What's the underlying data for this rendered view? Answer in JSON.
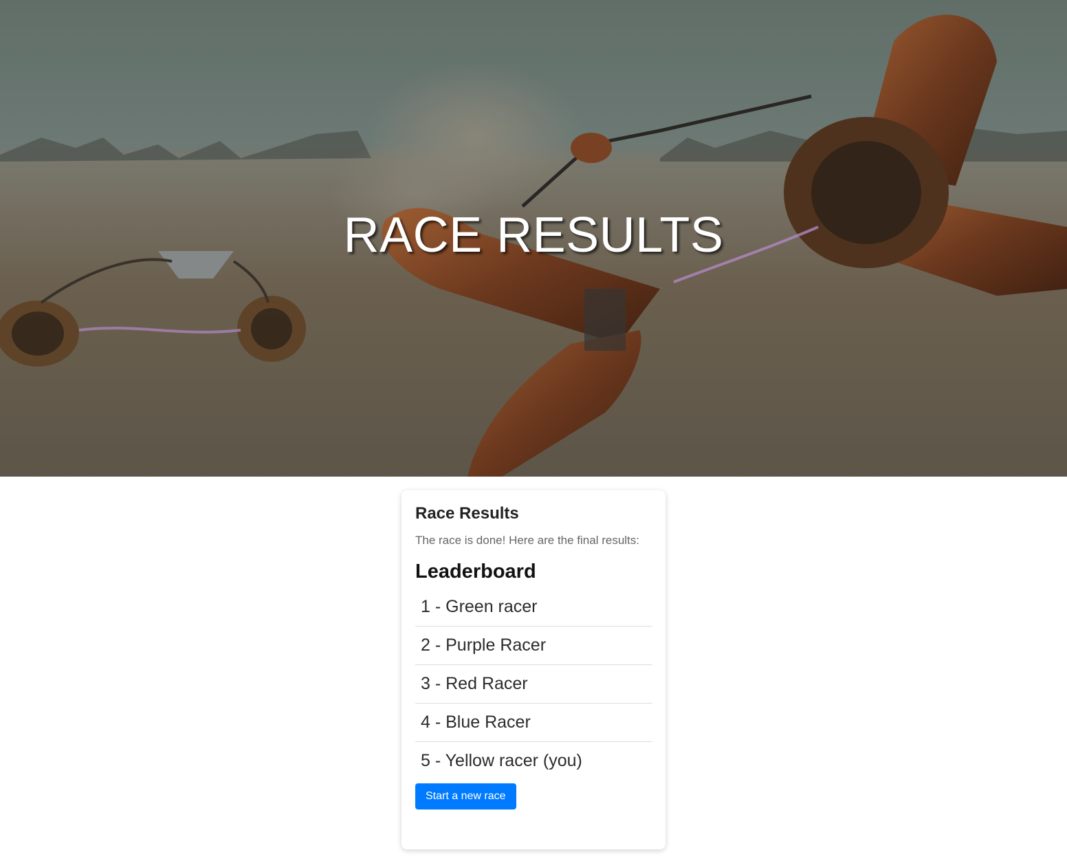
{
  "hero": {
    "title": "RACE RESULTS"
  },
  "card": {
    "title": "Race Results",
    "text": "The race is done! Here are the final results:",
    "leaderboard_heading": "Leaderboard",
    "leaderboard": [
      "1 - Green racer",
      "2 - Purple Racer",
      "3 - Red Racer",
      "4 - Blue Racer",
      "5 - Yellow racer (you)"
    ],
    "button_label": "Start a new race"
  },
  "colors": {
    "button": "#007bff",
    "hero_text": "#ffffff"
  }
}
